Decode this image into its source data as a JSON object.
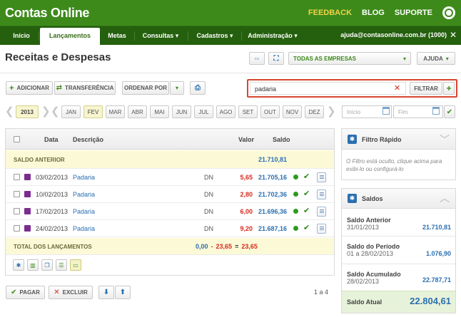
{
  "app": {
    "title": "Contas Online"
  },
  "top_links": {
    "feedback": "FEEDBACK",
    "blog": "BLOG",
    "suporte": "SUPORTE"
  },
  "nav": {
    "items": [
      "Início",
      "Lançamentos",
      "Metas",
      "Consultas ▾",
      "Cadastros ▾",
      "Administração ▾"
    ],
    "account": "ajuda@contasonline.com.br (1000)"
  },
  "page": {
    "title": "Receitas e Despesas"
  },
  "toolbar": {
    "empresas": "TODAS AS EMPRESAS",
    "ajuda": "AJUDA",
    "adicionar": "ADICIONAR",
    "transferencia": "TRANSFERÊNCIA",
    "ordenar": "ORDENAR POR",
    "filtrar": "FILTRAR"
  },
  "search": {
    "value": "padaria"
  },
  "year": "2013",
  "months": [
    "JAN",
    "FEV",
    "MAR",
    "ABR",
    "MAI",
    "JUN",
    "JUL",
    "AGO",
    "SET",
    "OUT",
    "NOV",
    "DEZ"
  ],
  "selected_month": "FEV",
  "date_filter": {
    "start_placeholder": "Início",
    "end_placeholder": "Fim"
  },
  "table": {
    "headers": {
      "data": "Data",
      "descricao": "Descrição",
      "valor": "Valor",
      "saldo": "Saldo"
    },
    "saldo_anterior": {
      "label": "SALDO ANTERIOR",
      "value": "21.710,81"
    },
    "rows": [
      {
        "date": "03/02/2013",
        "desc": "Padaria",
        "type": "DN",
        "valor": "5,65",
        "saldo": "21.705,16"
      },
      {
        "date": "10/02/2013",
        "desc": "Padaria",
        "type": "DN",
        "valor": "2,80",
        "saldo": "21.702,36"
      },
      {
        "date": "17/02/2013",
        "desc": "Padaria",
        "type": "DN",
        "valor": "6,00",
        "saldo": "21.696,36"
      },
      {
        "date": "24/02/2013",
        "desc": "Padaria",
        "type": "DN",
        "valor": "9,20",
        "saldo": "21.687,16"
      }
    ],
    "total": {
      "label": "TOTAL DOS LANÇAMENTOS",
      "receitas": "0,00",
      "minus": "-",
      "despesas": "23,65",
      "equals": "=",
      "result": "23,65"
    }
  },
  "footer": {
    "pagar": "PAGAR",
    "excluir": "EXCLUIR",
    "pagination": "1 a 4"
  },
  "filtro_rapido": {
    "title": "Filtro Rápido",
    "text": "O Filtro está oculto, clique acima para exibi-lo ou configurá-lo"
  },
  "saldos": {
    "title": "Saldos",
    "anterior": {
      "label": "Saldo Anterior",
      "date": "31/01/2013",
      "value": "21.710,81"
    },
    "periodo": {
      "label": "Saldo do Período",
      "date": "01 a 28/02/2013",
      "value": "1.076,90"
    },
    "acumulado": {
      "label": "Saldo Acumulado",
      "date": "28/02/2013",
      "value": "22.787,71"
    },
    "atual": {
      "label": "Saldo Atual",
      "value": "22.804,61"
    }
  },
  "colors": {
    "brand_green": "#3d8a1b",
    "nav_dark": "#25600e",
    "feedback_yellow": "#f1d247",
    "negative_red": "#d52b1e",
    "link_blue": "#2a6fb0",
    "category_purple": "#7b2d8f"
  }
}
